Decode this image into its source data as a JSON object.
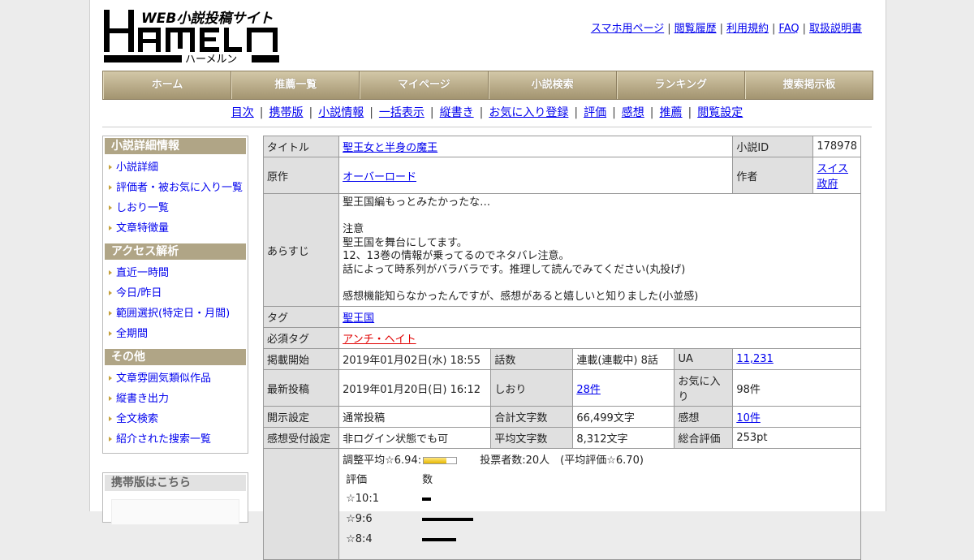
{
  "site": {
    "logo_tagline": "WEB小説投稿サイト",
    "logo_main": "HAMELN",
    "logo_kana": "ハーメルン",
    "accent_color": "#b0a586"
  },
  "top_links": [
    "スマホ用ページ",
    "閲覧履歴",
    "利用規約",
    "FAQ",
    "取扱説明書"
  ],
  "main_nav": [
    "ホーム",
    "推薦一覧",
    "マイページ",
    "小説検索",
    "ランキング",
    "捜索掲示板"
  ],
  "sub_nav": [
    "目次",
    "携帯版",
    "小説情報",
    "一括表示",
    "縦書き",
    "お気に入り登録",
    "評価",
    "感想",
    "推薦",
    "閲覧設定"
  ],
  "sidebar": {
    "sections": [
      {
        "title": "小説詳細情報",
        "items": [
          "小説詳細",
          "評価者・被お気に入り一覧",
          "しおり一覧",
          "文章特徴量"
        ]
      },
      {
        "title": "アクセス解析",
        "items": [
          "直近一時間",
          "今日/昨日",
          "範囲選択(特定日・月間)",
          "全期間"
        ]
      },
      {
        "title": "その他",
        "items": [
          "文章雰囲気類似作品",
          "縦書き出力",
          "全文検索",
          "紹介された搜索一覧"
        ]
      }
    ],
    "mobile_title": "携帯版はこちら"
  },
  "info": {
    "title_label": "タイトル",
    "title": "聖王女と半身の魔王",
    "id_label": "小説ID",
    "id": "178978",
    "original_label": "原作",
    "original": "オーバーロード",
    "author_label": "作者",
    "author": "スイス政府",
    "synopsis_label": "あらすじ",
    "synopsis": [
      "聖王国編もっとみたかったな…",
      "",
      "注意",
      "聖王国を舞台にしてます。",
      "12、13巻の情報が乗ってるのでネタバレ注意。",
      "話によって時系列がバラバラです。推理して読んでみてください(丸投げ)",
      "",
      "感想機能知らなかったんですが、感想があると嬉しいと知りました(小並感)"
    ],
    "tag_label": "タグ",
    "tag": "聖王国",
    "req_tag_label": "必須タグ",
    "req_tag": "アンチ・ヘイト",
    "stats": [
      [
        "掲載開始",
        "2019年01月02日(水) 18:55",
        "話数",
        "連載(連載中) 8話",
        "UA",
        "11,231"
      ],
      [
        "最新投稿",
        "2019年01月20日(日) 16:12",
        "しおり",
        "28件",
        "お気に入り",
        "98件"
      ],
      [
        "開示設定",
        "通常投稿",
        "合計文字数",
        "66,499文字",
        "感想",
        "10件"
      ],
      [
        "感想受付設定",
        "非ログイン状態でも可",
        "平均文字数",
        "8,312文字",
        "総合評価",
        "253pt"
      ]
    ],
    "rating": {
      "avg_text": "調整平均☆6.94:",
      "avg_value": 6.94,
      "votes_text": "投票者数:20人　(平均評価☆6.70)",
      "head_rating": "評価",
      "head_count": "数",
      "rows": [
        {
          "label": "☆10:1",
          "count": 1
        },
        {
          "label": "☆9:6",
          "count": 6
        },
        {
          "label": "☆8:4",
          "count": 4
        }
      ]
    }
  }
}
